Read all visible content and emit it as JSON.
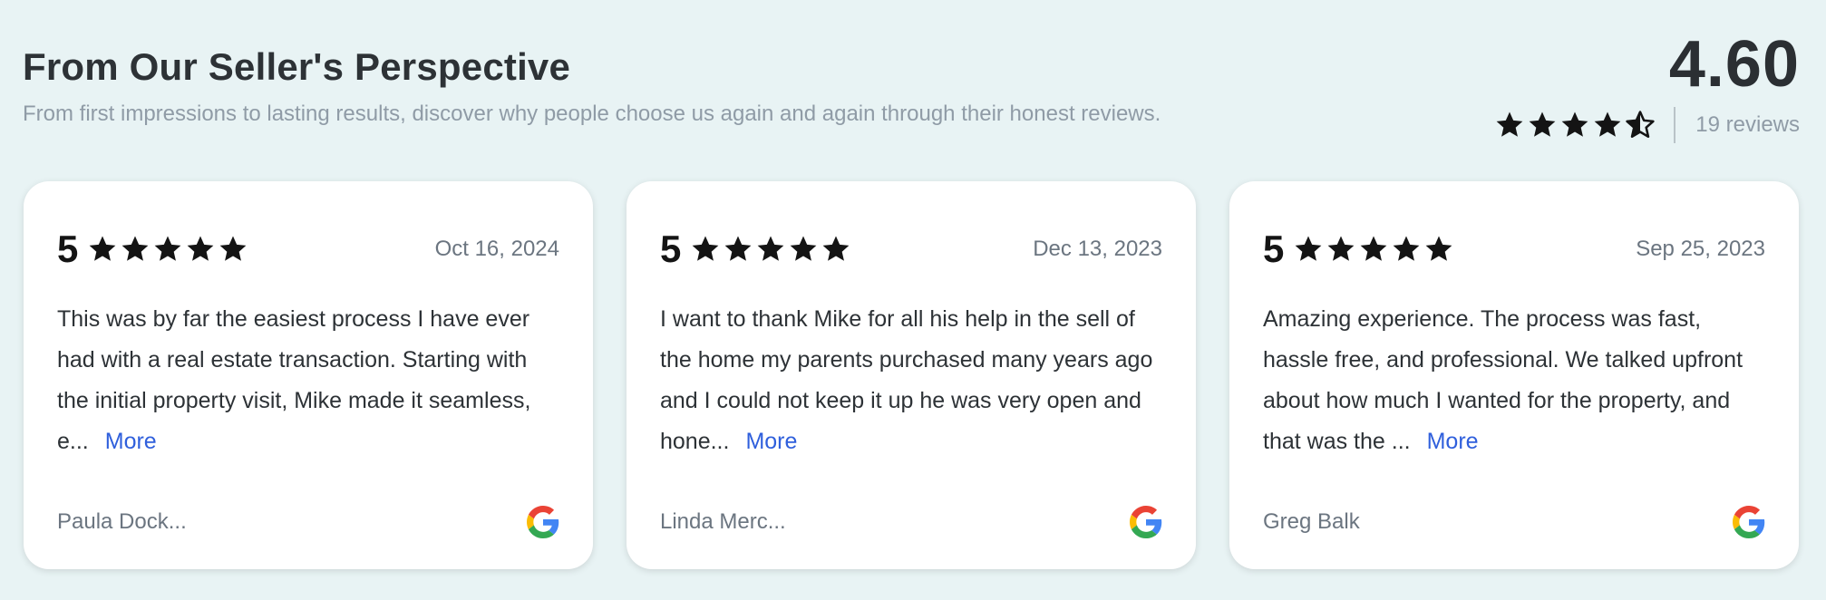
{
  "header": {
    "title": "From Our Seller's Perspective",
    "subtitle": "From first impressions to lasting results, discover why people choose us again and again through their honest reviews."
  },
  "summary": {
    "average": "4.60",
    "stars": 4.6,
    "reviews_count": "19 reviews"
  },
  "colors": {
    "background": "#e8f3f4",
    "star": "#141414",
    "link": "#2f5fdc"
  },
  "reviews": [
    {
      "rating": "5",
      "date": "Oct 16, 2024",
      "text": "This was by far the easiest process I have ever had with a real estate transaction. Starting with the initial property visit, Mike made it seamless, e...",
      "more": "More",
      "author": "Paula Dock...",
      "source_icon": "google-icon"
    },
    {
      "rating": "5",
      "date": "Dec 13, 2023",
      "text": "I want to thank Mike for all his help in the sell of the home my parents purchased many years ago and I could not keep it up he was very open and hone...",
      "more": "More",
      "author": "Linda Merc...",
      "source_icon": "google-icon"
    },
    {
      "rating": "5",
      "date": "Sep 25, 2023",
      "text": "Amazing experience. The process was fast, hassle free, and professional. We talked upfront about how much I wanted for the property, and that was the ...",
      "more": "More",
      "author": "Greg Balk",
      "source_icon": "google-icon"
    }
  ]
}
